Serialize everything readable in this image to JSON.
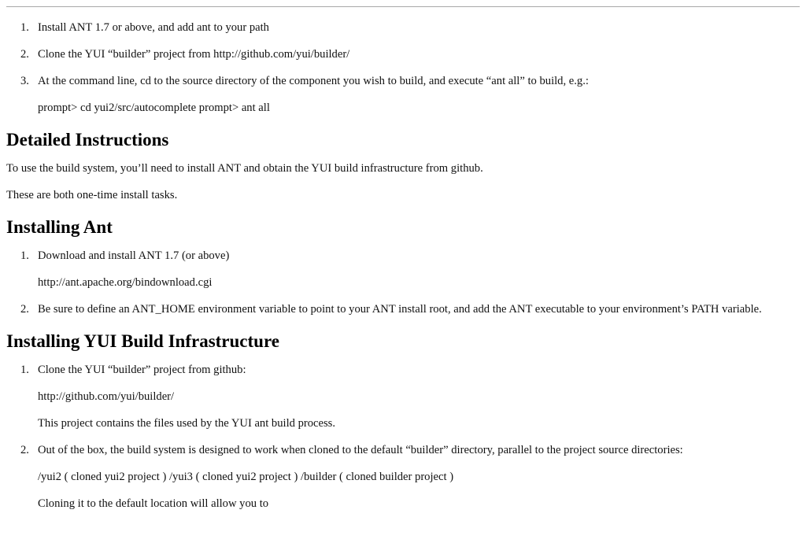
{
  "top_list": [
    {
      "num": "1.",
      "text": "Install ANT 1.7 or above, and add ant to your path"
    },
    {
      "num": "2.",
      "text": "Clone the YUI “builder” project from http://github.com/yui/builder/"
    },
    {
      "num": "3.",
      "text": "At the command line, cd to the source directory of the component you wish to build, and execute “ant all” to build, e.g.:",
      "sub": "prompt> cd yui2/src/autocomplete prompt> ant all"
    }
  ],
  "detailed": {
    "heading": "Detailed Instructions",
    "p1": "To use the build system, you’ll need to install ANT and obtain the YUI build infrastructure from github.",
    "p2": "These are both one-time install tasks."
  },
  "ant": {
    "heading": "Installing Ant",
    "items": [
      {
        "num": "1.",
        "text": "Download and install ANT 1.7 (or above)",
        "sub": "http://ant.apache.org/bindownload.cgi"
      },
      {
        "num": "2.",
        "text": "Be sure to define an ANT_HOME environment variable to point to your ANT install root, and add the ANT executable to your environment’s PATH variable."
      }
    ]
  },
  "yui": {
    "heading": "Installing YUI Build Infrastructure",
    "items": [
      {
        "num": "1.",
        "text": "Clone the YUI “builder” project from github:",
        "sub1": "http://github.com/yui/builder/",
        "sub2": "This project contains the files used by the YUI ant build process."
      },
      {
        "num": "2.",
        "text": "Out of the box, the build system is designed to work when cloned to the default “builder” directory, parallel to the project source directories:",
        "sub1": "/yui2 ( cloned yui2 project ) /yui3 ( cloned yui2 project ) /builder ( cloned builder project )",
        "sub2": "Cloning it to the default location will allow you to"
      }
    ]
  }
}
